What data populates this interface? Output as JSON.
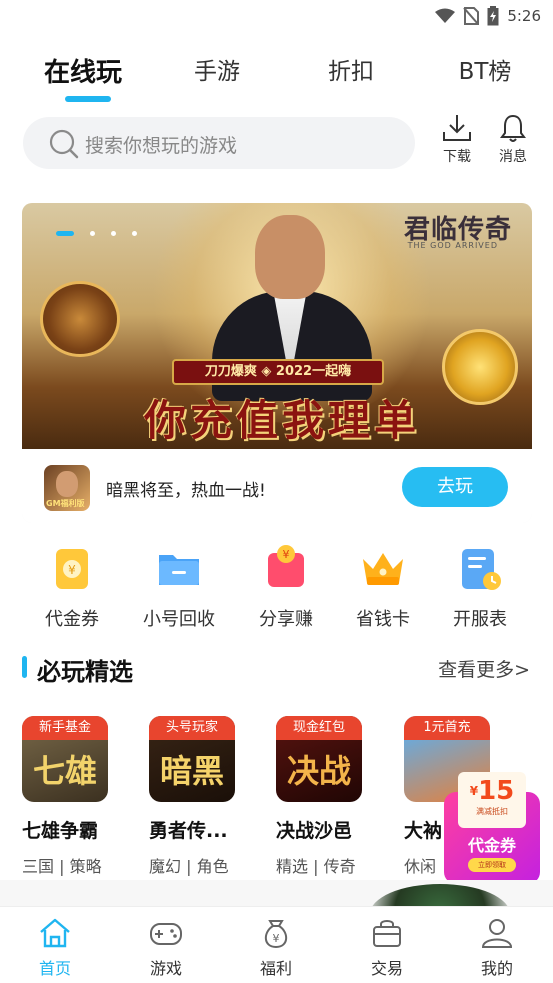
{
  "status_bar": {
    "time": "5:26"
  },
  "top_tabs": [
    {
      "label": "在线玩",
      "active": true
    },
    {
      "label": "手游",
      "active": false
    },
    {
      "label": "折扣",
      "active": false
    },
    {
      "label": "BT榜",
      "active": false
    }
  ],
  "search": {
    "placeholder": "搜索你想玩的游戏"
  },
  "tools": {
    "download_label": "下载",
    "messages_label": "消息"
  },
  "banner": {
    "game_logo": "君临传奇",
    "game_logo_sub": "THE GOD ARRIVED",
    "ribbon": "刀刀爆爽 ◈ 2022一起嗨",
    "slogan": "你充值我理单",
    "app_icon_text": "GM福利版",
    "description": "暗黑将至，热血一战!",
    "play_label": "去玩"
  },
  "quick_menu": [
    {
      "label": "代金券",
      "icon": "voucher-icon"
    },
    {
      "label": "小号回收",
      "icon": "folder-icon"
    },
    {
      "label": "分享赚",
      "icon": "red-packet-icon"
    },
    {
      "label": "省钱卡",
      "icon": "crown-icon"
    },
    {
      "label": "开服表",
      "icon": "schedule-icon"
    }
  ],
  "section": {
    "title": "必玩精选",
    "more": "查看更多>"
  },
  "games": [
    {
      "tag": "新手基金",
      "thumb_text": "七雄",
      "name": "七雄争霸",
      "tags": "三国 | 策略"
    },
    {
      "tag": "头号玩家",
      "thumb_text": "暗黑",
      "name": "勇者传...",
      "tags": "魔幻 | 角色"
    },
    {
      "tag": "现金红包",
      "thumb_text": "决战",
      "name": "决战沙邑",
      "tags": "精选 | 传奇"
    },
    {
      "tag": "1元首充",
      "thumb_text": "",
      "name": "大衲",
      "tags": "休闲"
    }
  ],
  "coupon": {
    "amount": "15",
    "sub": "满减抵扣",
    "label": "代金券",
    "button": "立即领取"
  },
  "bottom_nav": [
    {
      "label": "首页",
      "active": true
    },
    {
      "label": "游戏",
      "active": false
    },
    {
      "label": "福利",
      "active": false
    },
    {
      "label": "交易",
      "active": false
    },
    {
      "label": "我的",
      "active": false
    }
  ],
  "colors": {
    "accent": "#1fb5f0",
    "tag_red": "#e8452e",
    "coupon_pink": "#ff3fa0"
  }
}
